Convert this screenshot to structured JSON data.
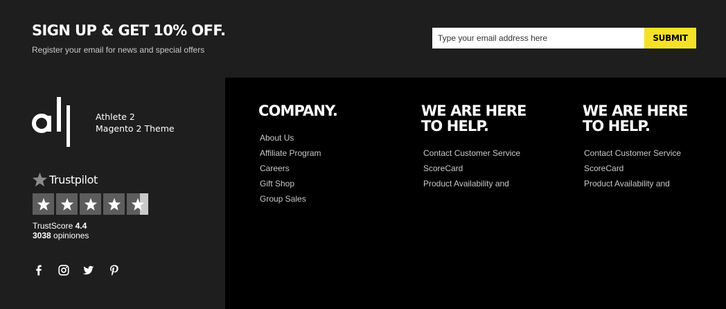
{
  "signup": {
    "title": "SIGN UP & GET 10% OFF.",
    "subtitle": "Register your email for news and special offers",
    "email_placeholder": "Type your email address here",
    "submit_label": "SUBMIT",
    "accent_color": "#f6e12a"
  },
  "brand": {
    "logo_icon": "athlete-logo",
    "line1": "Athlete 2",
    "line2": "Magento 2 Theme"
  },
  "trustpilot": {
    "name": "Trustpilot",
    "rating": 4.4,
    "max_rating": 5,
    "score_label": "TrustScore",
    "score_value": "4.4",
    "reviews_count": "3038",
    "reviews_label": "opiniones"
  },
  "social": [
    {
      "icon": "facebook-icon"
    },
    {
      "icon": "instagram-icon"
    },
    {
      "icon": "twitter-icon"
    },
    {
      "icon": "pinterest-icon"
    }
  ],
  "columns": [
    {
      "title": "COMPANY.",
      "links": [
        "About Us",
        "Affiliate Program",
        "Careers",
        "Gift Shop",
        "Group Sales"
      ]
    },
    {
      "title_line1": "WE ARE HERE",
      "title_line2": "TO HELP.",
      "links": [
        "Contact Customer Service",
        "ScoreCard",
        "Product Availability and"
      ]
    },
    {
      "title_line1": "WE ARE HERE",
      "title_line2": "TO HELP.",
      "links": [
        "Contact Customer Service",
        "ScoreCard",
        "Product Availability and"
      ]
    }
  ]
}
